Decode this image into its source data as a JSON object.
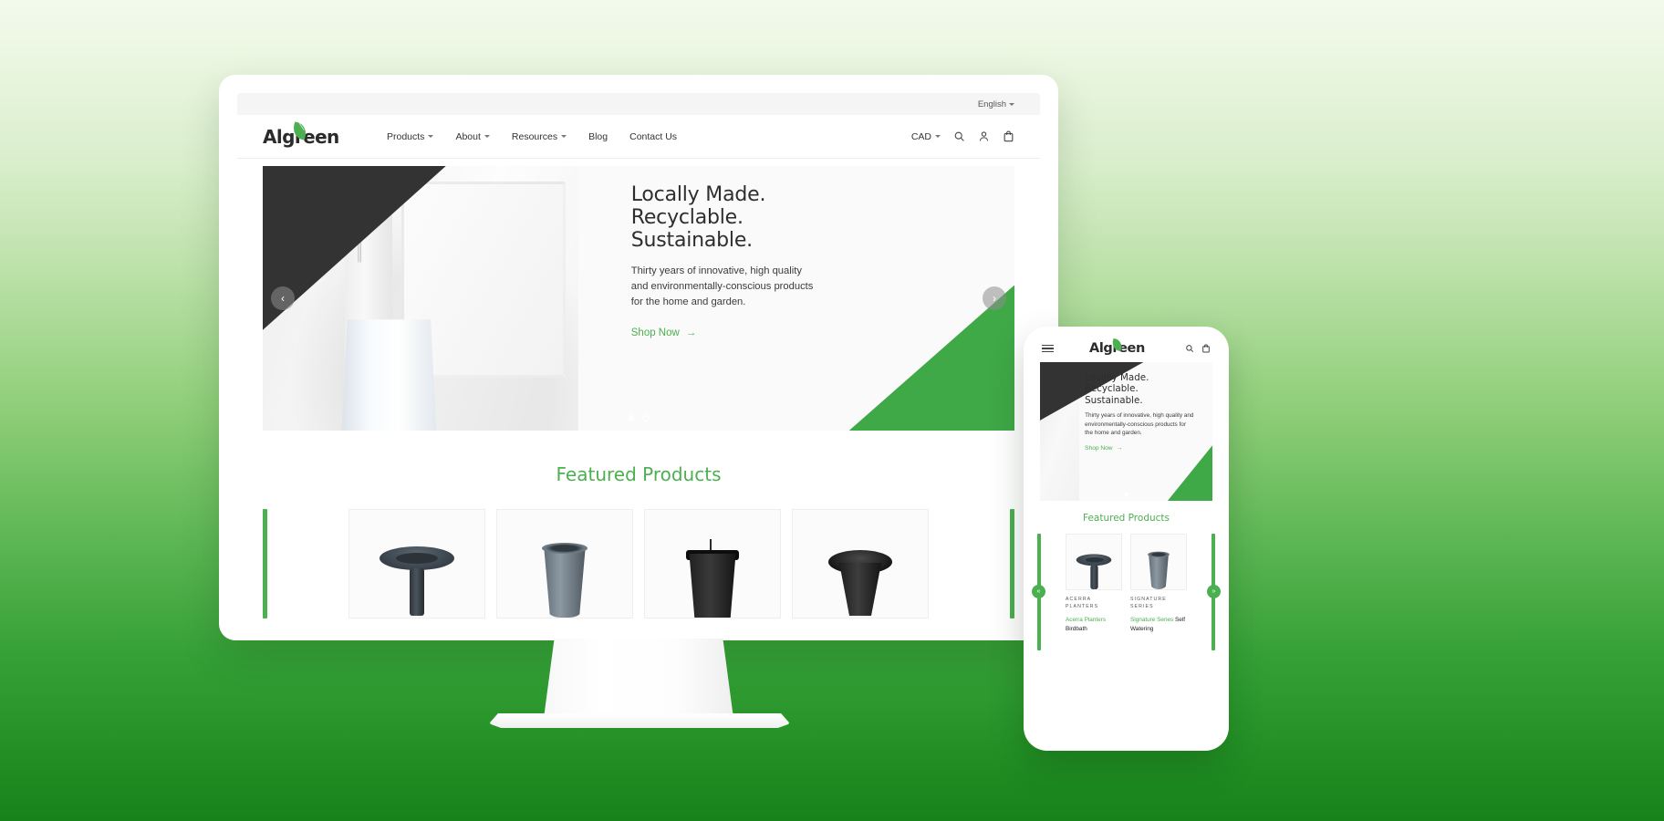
{
  "theme": {
    "brand_green": "#4caf50",
    "accent_green": "#3fa847",
    "bg_gradient_top": "#f2faec",
    "bg_gradient_bottom": "#17821a",
    "dark": "#333333"
  },
  "desktop": {
    "topbar": {
      "language": "English",
      "language_caret": "chevron-down-icon"
    },
    "header": {
      "logo_text": "Algreen",
      "nav": [
        {
          "label": "Products",
          "has_caret": true
        },
        {
          "label": "About",
          "has_caret": true
        },
        {
          "label": "Resources",
          "has_caret": true
        },
        {
          "label": "Blog",
          "has_caret": false
        },
        {
          "label": "Contact Us",
          "has_caret": false
        }
      ],
      "currency": "CAD",
      "icons": [
        "search-icon",
        "account-icon",
        "bag-icon"
      ]
    },
    "hero": {
      "heading_line1": "Locally Made.",
      "heading_line2": "Recyclable.",
      "heading_line3": "Sustainable.",
      "subtext": "Thirty years of innovative, high quality and environmentally-conscious products for the home and garden.",
      "cta_label": "Shop Now",
      "cta_arrow": "→",
      "prev_arrow": "‹",
      "next_arrow": "›",
      "slides": 2,
      "active_slide": 1
    },
    "featured": {
      "title": "Featured Products",
      "products": [
        {
          "shape": "birdbath"
        },
        {
          "shape": "vase"
        },
        {
          "shape": "square-planter"
        },
        {
          "shape": "urn"
        }
      ]
    }
  },
  "mobile": {
    "header": {
      "menu_icon": "hamburger-icon",
      "logo_text": "Algreen",
      "icons": [
        "search-icon",
        "bag-icon"
      ]
    },
    "hero": {
      "heading_line1": "Locally Made.",
      "heading_line2": "Recyclable.",
      "heading_line3": "Sustainable.",
      "subtext": "Thirty years of innovative, high quality and environmentally-conscious products for the home and garden.",
      "cta_label": "Shop Now",
      "cta_arrow": "→"
    },
    "featured": {
      "title": "Featured Products",
      "prev_arrow": "«",
      "next_arrow": "»",
      "products": [
        {
          "category": "ACERRA PLANTERS",
          "name_green": "Acerra Planters",
          "name_dark": "Birdbath",
          "shape": "birdbath"
        },
        {
          "category": "SIGNATURE SERIES",
          "name_green": "Signature Series",
          "name_dark": "Self Watering",
          "shape": "vase"
        }
      ]
    }
  }
}
